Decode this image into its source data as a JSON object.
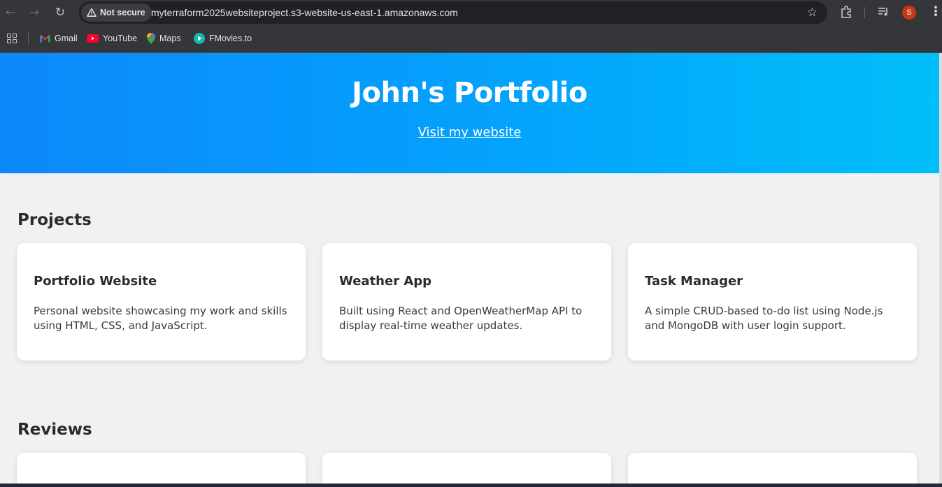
{
  "browser": {
    "security_label": "Not secure",
    "url": "myterraform2025websiteproject.s3-website-us-east-1.amazonaws.com",
    "profile_initial": "S",
    "bookmarks": [
      {
        "label": "Gmail",
        "icon": "gmail-icon"
      },
      {
        "label": "YouTube",
        "icon": "youtube-icon"
      },
      {
        "label": "Maps",
        "icon": "maps-icon"
      },
      {
        "label": "FMovies.to",
        "icon": "fmovies-icon"
      }
    ]
  },
  "hero": {
    "title": "John's Portfolio",
    "link_label": "Visit my website",
    "gradient_start": "#0d88fb",
    "gradient_end": "#01bff9"
  },
  "projects": {
    "title": "Projects",
    "items": [
      {
        "name": "Portfolio Website",
        "description": "Personal website showcasing my work and skills using HTML, CSS, and JavaScript."
      },
      {
        "name": "Weather App",
        "description": "Built using React and OpenWeatherMap API to display real-time weather updates."
      },
      {
        "name": "Task Manager",
        "description": "A simple CRUD-based to-do list using Node.js and MongoDB with user login support."
      }
    ]
  },
  "reviews": {
    "title": "Reviews"
  }
}
